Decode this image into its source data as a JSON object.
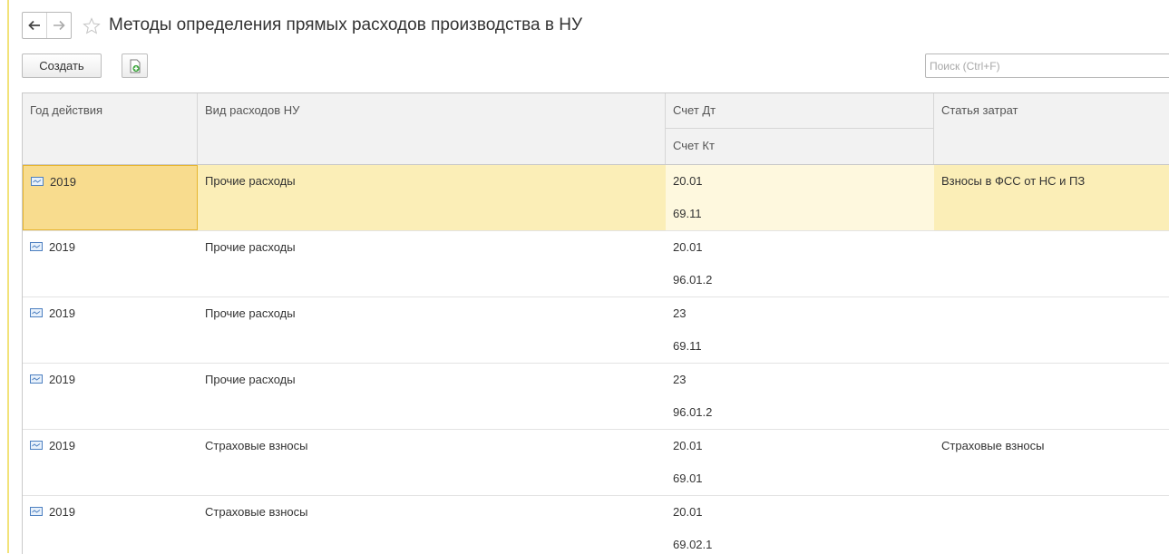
{
  "window": {
    "title": "Методы определения прямых расходов производства в НУ"
  },
  "toolbar": {
    "create_label": "Создать",
    "search_placeholder": "Поиск (Ctrl+F)"
  },
  "table": {
    "columns": {
      "year": "Год действия",
      "kind": "Вид расходов НУ",
      "debit": "Счет Дт",
      "credit": "Счет Кт",
      "item": "Статья затрат"
    },
    "rows": [
      {
        "year": "2019",
        "kind": "Прочие расходы",
        "debit": "20.01",
        "credit": "69.11",
        "item": "Взносы в ФСС от НС и ПЗ"
      },
      {
        "year": "2019",
        "kind": "Прочие расходы",
        "debit": "20.01",
        "credit": "96.01.2",
        "item": ""
      },
      {
        "year": "2019",
        "kind": "Прочие расходы",
        "debit": "23",
        "credit": "69.11",
        "item": ""
      },
      {
        "year": "2019",
        "kind": "Прочие расходы",
        "debit": "23",
        "credit": "96.01.2",
        "item": ""
      },
      {
        "year": "2019",
        "kind": "Страховые взносы",
        "debit": "20.01",
        "credit": "69.01",
        "item": "Страховые взносы"
      },
      {
        "year": "2019",
        "kind": "Страховые взносы",
        "debit": "20.01",
        "credit": "69.02.1",
        "item": ""
      }
    ]
  },
  "colors": {
    "selected_row": "#fbeeb7",
    "selected_cell": "#f8dc8e",
    "header_bg": "#f2f2f2"
  },
  "icons": [
    "back-arrow-icon",
    "forward-arrow-icon",
    "star-icon",
    "copy-document-icon",
    "record-icon"
  ]
}
